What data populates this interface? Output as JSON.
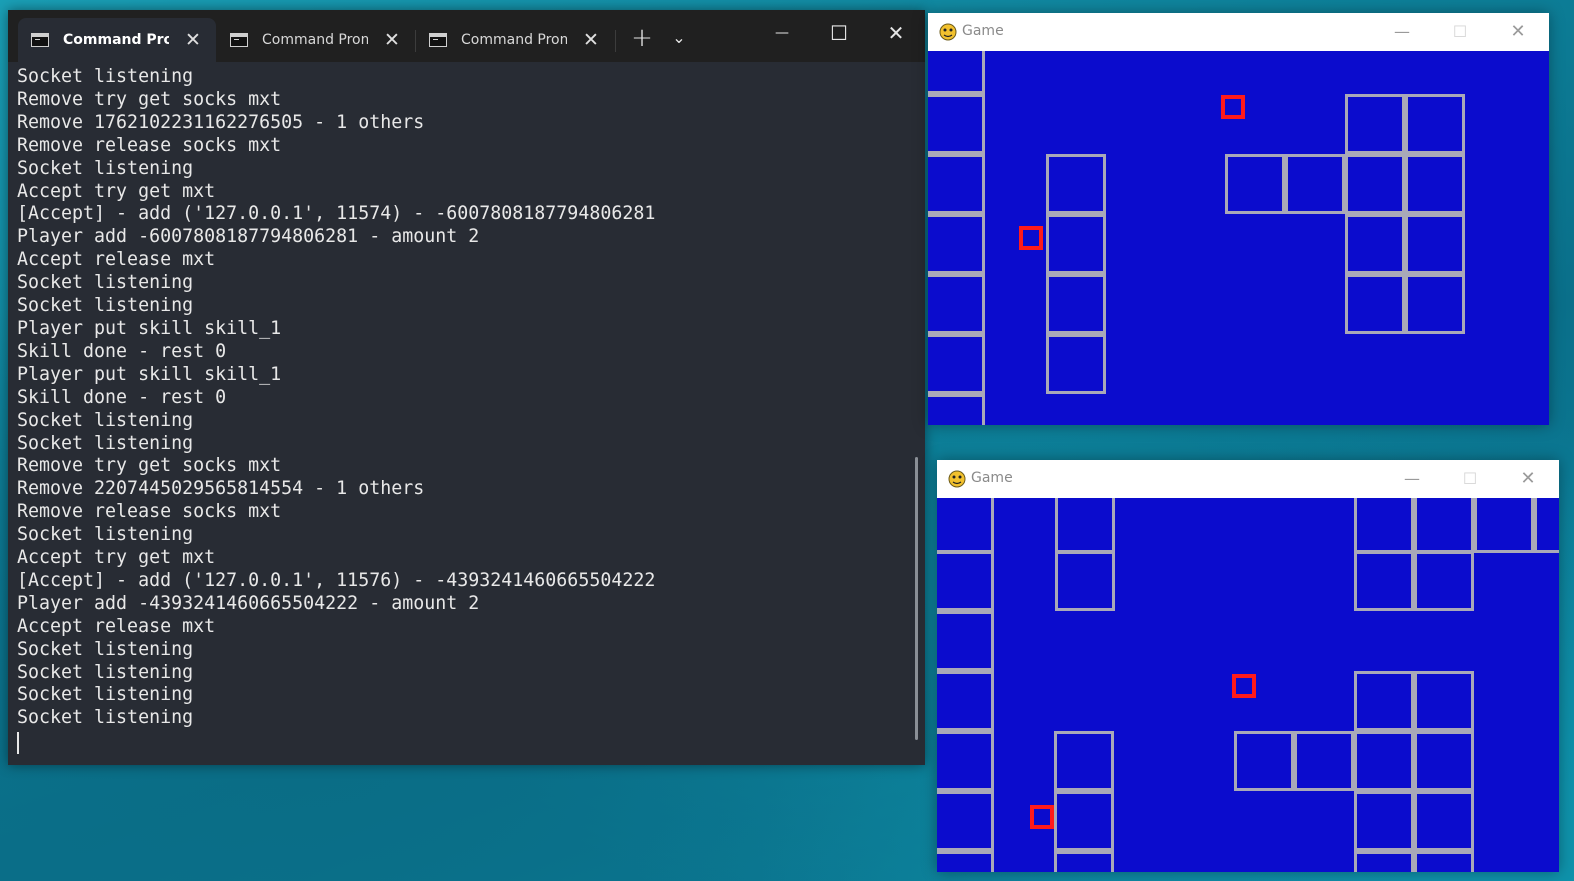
{
  "terminal": {
    "tabs": [
      {
        "label": "Command Prompt",
        "active": true
      },
      {
        "label": "Command Prompt",
        "active": false
      },
      {
        "label": "Command Prompt",
        "active": false
      }
    ],
    "new_tab_symbol": "+",
    "dropdown_symbol": "⌄",
    "close_symbol": "✕",
    "minimize_symbol": "—",
    "maximize_symbol": "☐",
    "lines": [
      "Socket listening",
      "Remove try get socks mxt",
      "Remove 1762102231162276505 - 1 others",
      "Remove release socks mxt",
      "Socket listening",
      "Accept try get mxt",
      "[Accept] - add ('127.0.0.1', 11574) - -6007808187794806281",
      "Player add -6007808187794806281 - amount 2",
      "Accept release mxt",
      "Socket listening",
      "Socket listening",
      "Player put skill skill_1",
      "Skill done - rest 0",
      "Player put skill skill_1",
      "Skill done - rest 0",
      "Socket listening",
      "Socket listening",
      "Remove try get socks mxt",
      "Remove 2207445029565814554 - 1 others",
      "Remove release socks mxt",
      "Socket listening",
      "Accept try get mxt",
      "[Accept] - add ('127.0.0.1', 11576) - -4393241460665504222",
      "Player add -4393241460665504222 - amount 2",
      "Accept release mxt",
      "Socket listening",
      "Socket listening",
      "Socket listening",
      "Socket listening"
    ]
  },
  "game_windows": [
    {
      "title": "Game",
      "icon": "pygame-snake-icon"
    },
    {
      "title": "Game",
      "icon": "pygame-snake-icon"
    }
  ],
  "colors": {
    "game_background": "#0b0ccd",
    "tile_border": "#a9a9b8",
    "player_marker": "#ff1a1a",
    "terminal_background": "#282c34"
  }
}
